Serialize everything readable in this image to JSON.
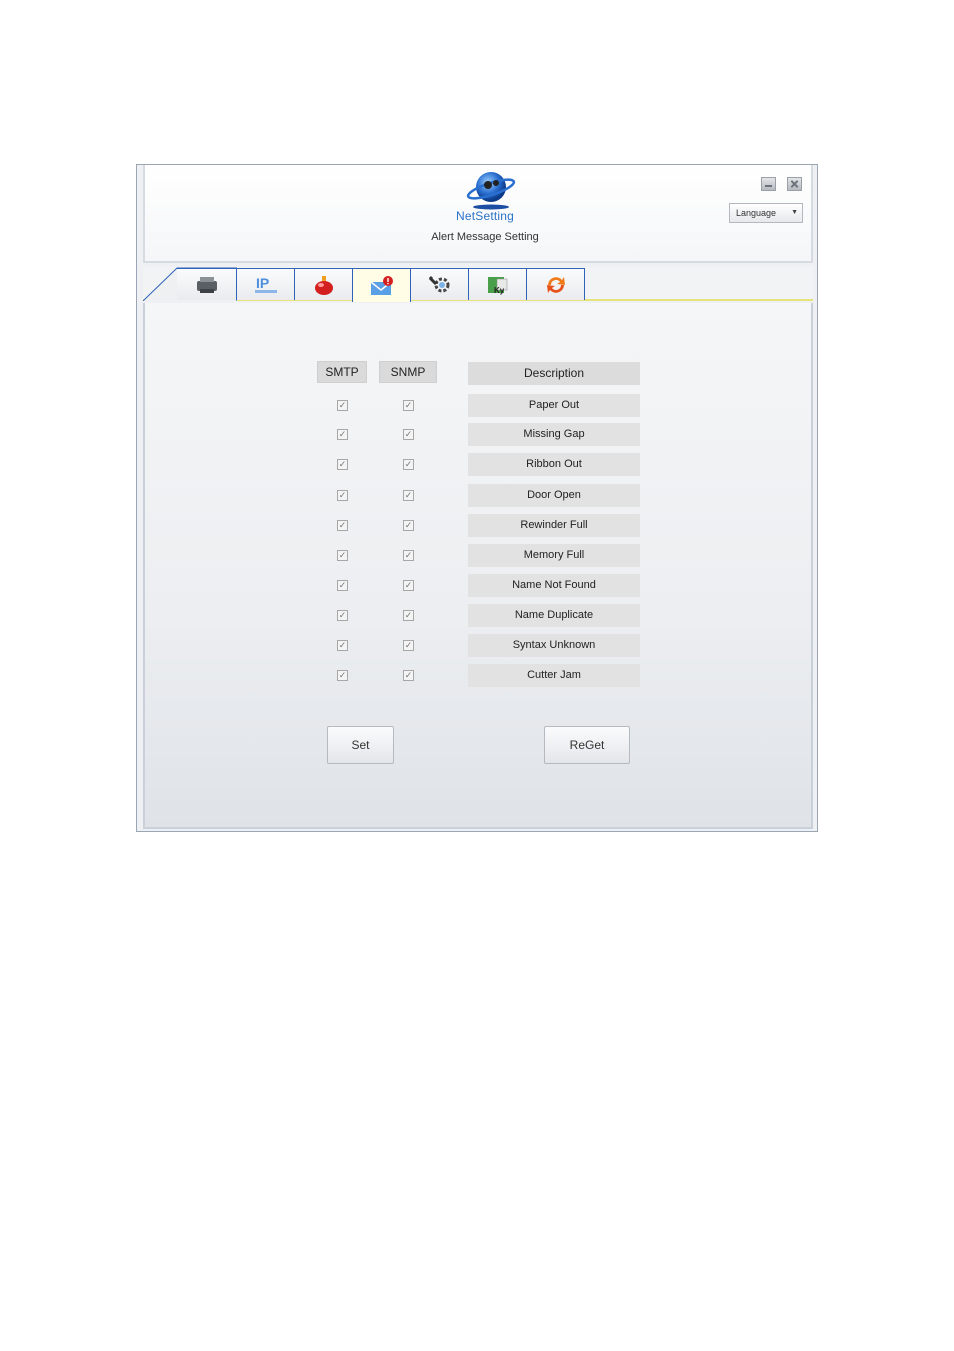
{
  "app": {
    "name": "NetSetting",
    "subtitle": "Alert Message Setting"
  },
  "header": {
    "language_label": "Language"
  },
  "tabs": [
    {
      "icon": "printer-icon"
    },
    {
      "icon": "ip-network-icon"
    },
    {
      "icon": "alarm-beacon-icon"
    },
    {
      "icon": "alert-mail-icon",
      "active": true
    },
    {
      "icon": "gear-tools-icon"
    },
    {
      "icon": "key-config-icon"
    },
    {
      "icon": "refresh-arrows-icon"
    }
  ],
  "table": {
    "headers": {
      "smtp": "SMTP",
      "snmp": "SNMP",
      "description": "Description"
    },
    "rows": [
      {
        "description": "Paper Out",
        "smtp": true,
        "snmp": true
      },
      {
        "description": "Missing Gap",
        "smtp": true,
        "snmp": true
      },
      {
        "description": "Ribbon Out",
        "smtp": true,
        "snmp": true
      },
      {
        "description": "Door Open",
        "smtp": true,
        "snmp": true
      },
      {
        "description": "Rewinder Full",
        "smtp": true,
        "snmp": true
      },
      {
        "description": "Memory Full",
        "smtp": true,
        "snmp": true
      },
      {
        "description": "Name Not Found",
        "smtp": true,
        "snmp": true
      },
      {
        "description": "Name Duplicate",
        "smtp": true,
        "snmp": true
      },
      {
        "description": "Syntax Unknown",
        "smtp": true,
        "snmp": true
      },
      {
        "description": "Cutter Jam",
        "smtp": true,
        "snmp": true
      }
    ]
  },
  "buttons": {
    "set": "Set",
    "reget": "ReGet"
  },
  "colors": {
    "tab_border": "#2f63b8",
    "active_tab_underline": "#e7e37b",
    "logo_blue": "#2a72c8"
  }
}
